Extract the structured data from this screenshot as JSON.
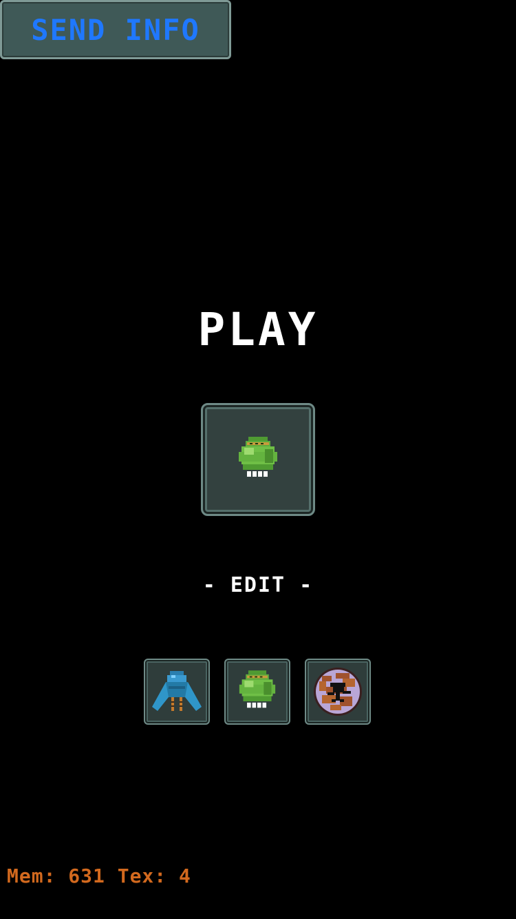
{
  "header": {
    "send_info_label": "SEND INFO"
  },
  "main": {
    "play_label": "PLAY",
    "selected_character_icon": "green-robot-icon",
    "edit_label": "- EDIT -",
    "edit_slots": [
      {
        "icon": "blue-ship-icon"
      },
      {
        "icon": "green-robot-icon"
      },
      {
        "icon": "planet-icon"
      }
    ]
  },
  "debug": {
    "text": "Mem: 631 Tex: 4"
  },
  "colors": {
    "send_info_text": "#1f78ff",
    "debug_text": "#d2691e",
    "panel_fill": "#2f3d3b",
    "panel_border": "#6e8a86"
  }
}
